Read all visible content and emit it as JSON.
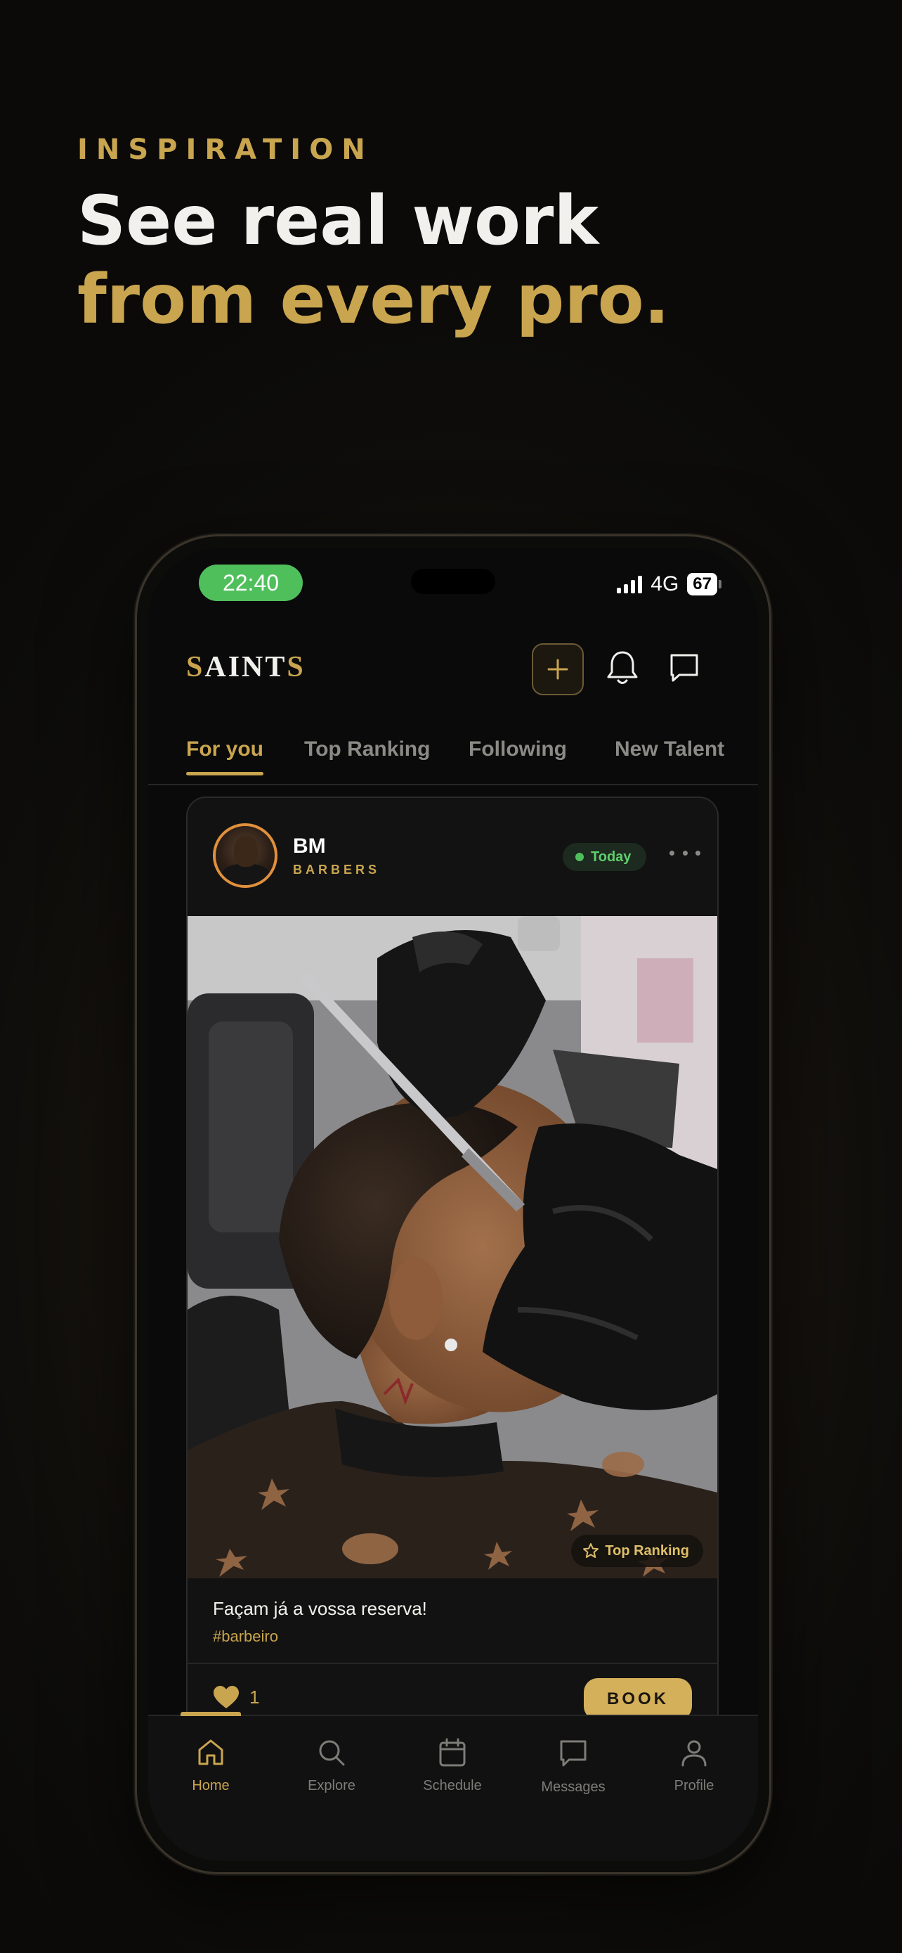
{
  "promo": {
    "eyebrow": "INSPIRATION",
    "headline_line1": "See real work",
    "headline_line2": "from every pro."
  },
  "status_bar": {
    "time": "22:40",
    "network": "4G",
    "battery": "67"
  },
  "app": {
    "logo_first": "S",
    "logo_middle": "AINT",
    "logo_last": "S",
    "header_icons": [
      "plus-icon",
      "bell-icon",
      "chat-icon"
    ]
  },
  "tabs": [
    {
      "label": "For you",
      "active": true
    },
    {
      "label": "Top Ranking",
      "active": false
    },
    {
      "label": "Following",
      "active": false
    },
    {
      "label": "New Talent",
      "active": false
    }
  ],
  "post": {
    "author": "BM",
    "author_type": "BARBERS",
    "date_badge": "Today",
    "image_badge": "Top Ranking",
    "caption": "Façam já a vossa reserva!",
    "hashtag": "#barbeiro",
    "likes": "1",
    "book_label": "BOOK"
  },
  "bottom_nav": [
    {
      "label": "Home",
      "icon": "home-icon",
      "active": true
    },
    {
      "label": "Explore",
      "icon": "search-icon",
      "active": false
    },
    {
      "label": "Schedule",
      "icon": "calendar-icon",
      "active": false
    },
    {
      "label": "Messages",
      "icon": "message-icon",
      "active": false
    },
    {
      "label": "Profile",
      "icon": "person-icon",
      "active": false
    }
  ],
  "colors": {
    "accent_gold": "#c9a54f",
    "status_green": "#4fbf5c",
    "background": "#0a0a0a"
  }
}
